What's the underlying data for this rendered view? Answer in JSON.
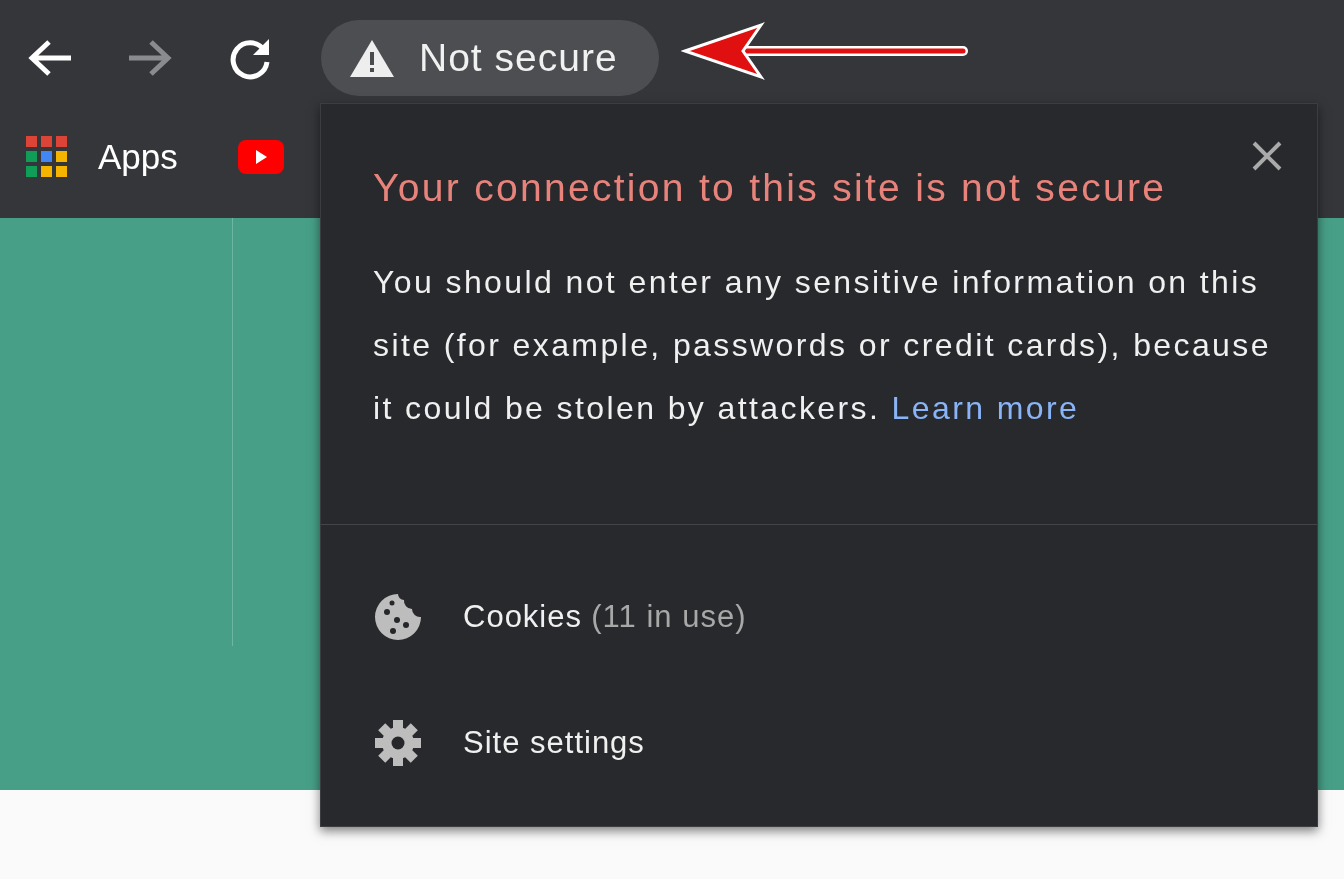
{
  "toolbar": {
    "nav_buttons": [
      {
        "kind": "back",
        "disabled": false
      },
      {
        "kind": "forward",
        "disabled": true
      },
      {
        "kind": "reload",
        "disabled": false
      }
    ],
    "address_chip": {
      "label": "Not secure"
    }
  },
  "bookmarks": [
    {
      "kind": "apps",
      "label": "Apps"
    },
    {
      "kind": "youtube"
    }
  ],
  "popup": {
    "title": "Your connection to this site is not secure",
    "body": "You should not enter any sensitive information on this site (for example, passwords or credit cards), because it could be stolen by attackers.",
    "link": "Learn more",
    "items": [
      {
        "kind": "cookies",
        "label": "Cookies",
        "detail": "(11 in use)"
      },
      {
        "kind": "settings",
        "label": "Site settings"
      }
    ]
  }
}
